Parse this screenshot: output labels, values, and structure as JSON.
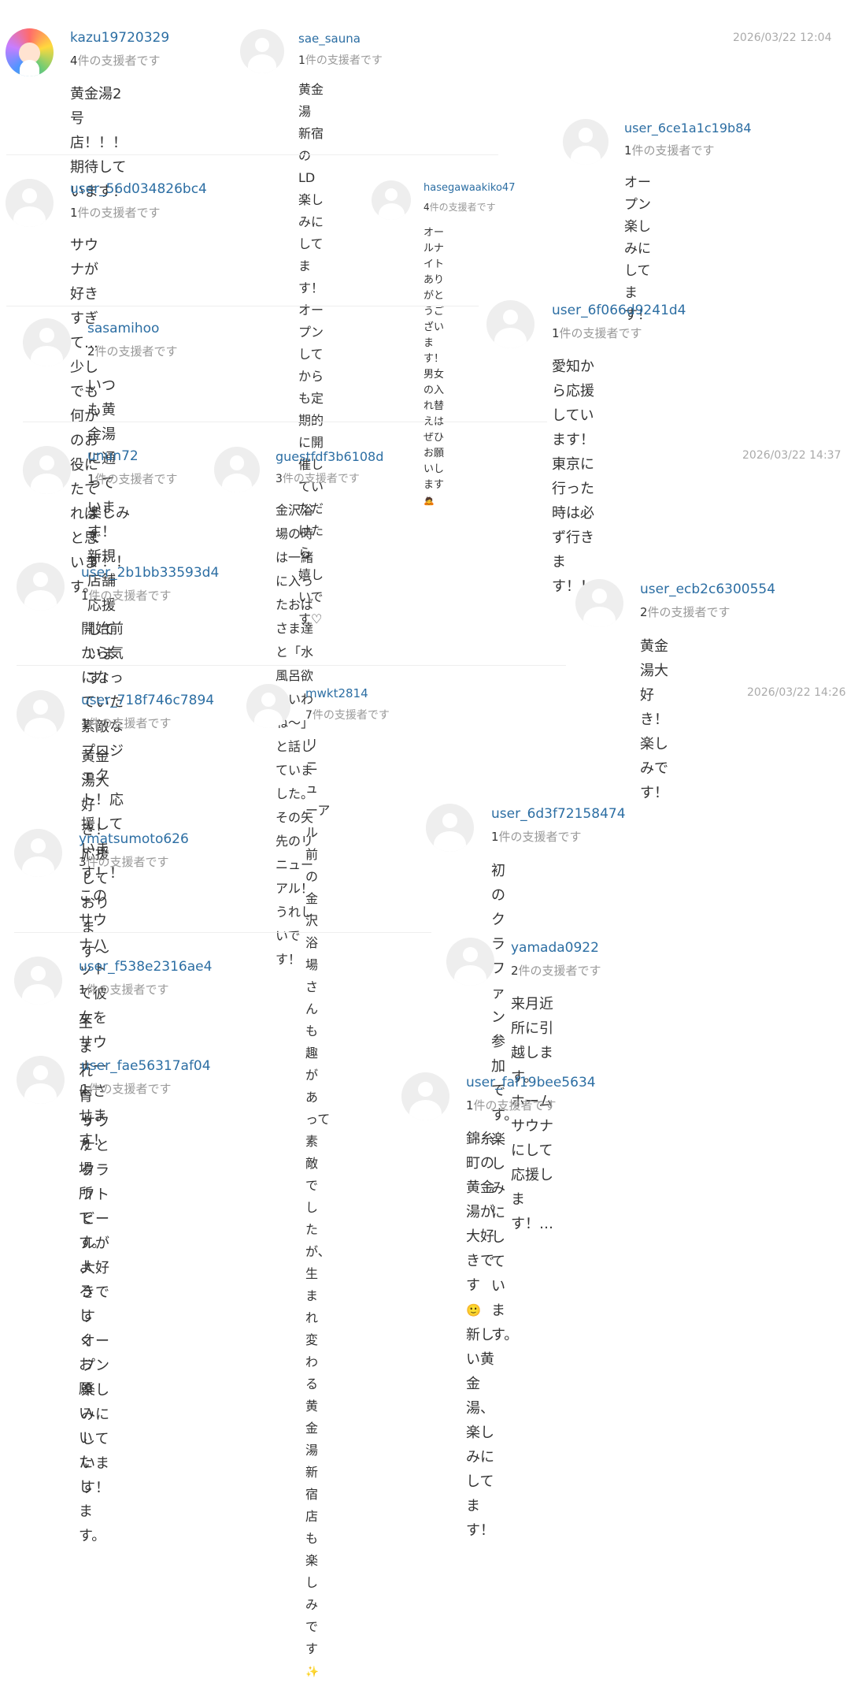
{
  "count_suffix": "件の支援者です",
  "comments": [
    {
      "name": "kazu19720329",
      "count": "4",
      "message": "黄金湯2号店！！！\n期待しています！"
    },
    {
      "name": "sae_sauna",
      "count": "1",
      "message": "黄金湯 新宿のLD楽しみにしてます！オープンしてからも定期的に開催していただけたら\n嬉しいです♡",
      "date": "2026/03/22 12:04"
    },
    {
      "name": "user_6ce1a1c19b84",
      "count": "1",
      "message": "オープン楽しみにしてます！"
    },
    {
      "name": "user_56d034826bc4",
      "count": "1",
      "message": "サウナが好きすぎて…\n少しでも何かのお役にたてればと思います。"
    },
    {
      "name": "hasegawaakiko47",
      "count": "4",
      "message": "オールナイトありがとうございます！男女の入れ替えはぜひお願いします",
      "emoji": "🙇"
    },
    {
      "name": "sasamihoo",
      "count": "2",
      "message": "いつも黄金湯に通っています！新規店舗応援しています！"
    },
    {
      "name": "user_6f066d9241d4",
      "count": "1",
      "message": "愛知から応援しています！\n東京に行った時は必ず行きます！！"
    },
    {
      "name": "unun72",
      "count": "1",
      "message": "楽しみです！！"
    },
    {
      "name": "guestfdf3b6108d",
      "count": "3",
      "message": "金沢浴場の時は一緒に入ったおばさま達と「水風呂欲しいわね〜」と話していました。\nその矢先のリニューアル！うれしいです！",
      "date": "2026/03/22 14:37"
    },
    {
      "name": "user_2b1bb33593d4",
      "count": "1",
      "message": "開始前から気になっていた素敵なプロジェクト！応援しています！！"
    },
    {
      "name": "user_ecb2c6300554",
      "count": "2",
      "message": "黄金湯大好き！楽しみです！"
    },
    {
      "name": "user_718f746c7894",
      "count": "1",
      "message": "黄金湯大好き！\n応援しております〜"
    },
    {
      "name": "mwkt2814",
      "count": "7",
      "message": "リニューアル前の金沢浴場さんも趣があって素敵でしたが、生まれ変わる黄金湯新宿店\nも楽しみです",
      "emoji": "✨",
      "date": "2026/03/22 14:26"
    },
    {
      "name": "user_6d3f72158474",
      "count": "1",
      "message": "初のクラファン参加です。楽しみにしています。"
    },
    {
      "name": "ymatsumoto626",
      "count": "3",
      "message": "このサウナハットで彼女をサウナーにさせます！"
    },
    {
      "name": "user_f538e2316ae4",
      "count": "1",
      "message": "生まれ育った場所です。よろしくお願いいたします。"
    },
    {
      "name": "yamada0922",
      "count": "2",
      "message": "来月近所に引越します。\nホームサウナにして応援します！…"
    },
    {
      "name": "user_fae56317af04",
      "count": "1",
      "message": "サウナとクラフトビールが大好きです\nオープン楽しみにしています！"
    },
    {
      "name": "user_faf19bee5634",
      "count": "1",
      "message": "錦糸町の黄金湯が大好きです",
      "emoji": "🙂",
      "message2": "新しい黄金湯、楽しみにしてます！"
    }
  ]
}
